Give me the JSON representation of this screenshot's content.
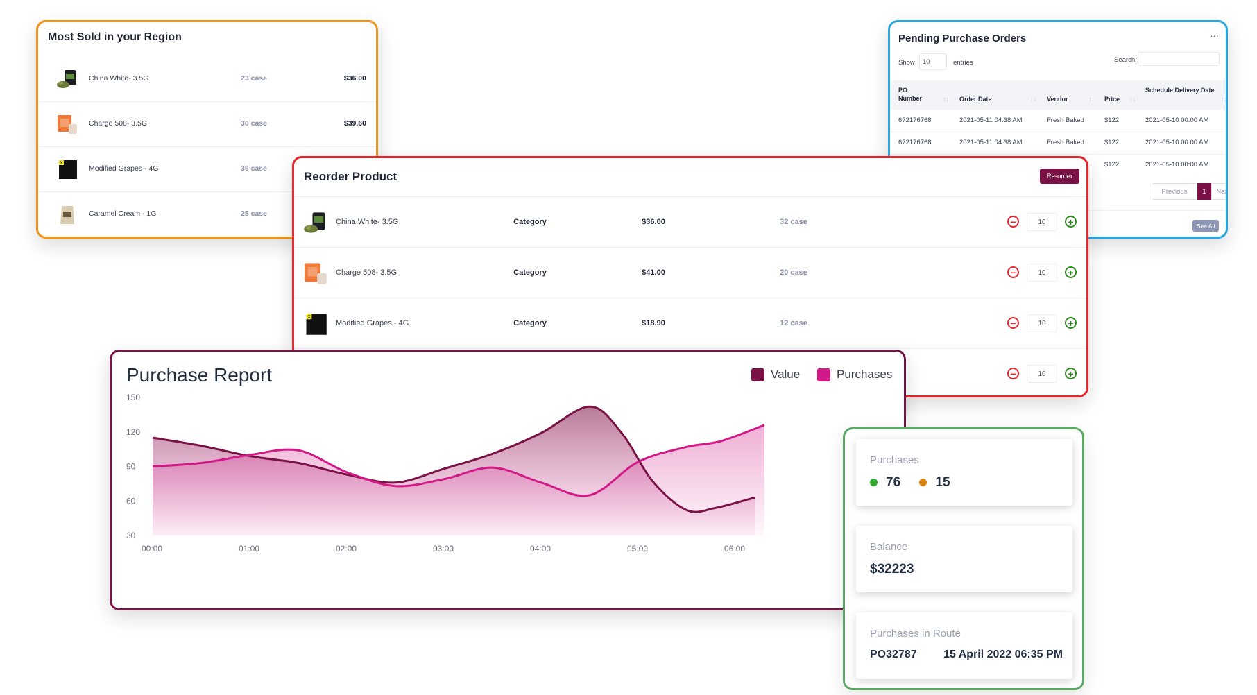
{
  "most_sold": {
    "title": "Most Sold in your Region",
    "items": [
      {
        "name": "China White- 3.5G",
        "cases": "23 case",
        "price": "$36.00",
        "thumb": "flower-jar-icon"
      },
      {
        "name": "Charge 508- 3.5G",
        "cases": "30 case",
        "price": "$39.60",
        "thumb": "orange-box-icon"
      },
      {
        "name": "Modified Grapes - 4G",
        "cases": "36 case",
        "price": "",
        "thumb": "black-box-icon"
      },
      {
        "name": "Caramel Cream - 1G",
        "cases": "25 case",
        "price": "",
        "thumb": "pouch-icon"
      }
    ]
  },
  "pending": {
    "title": "Pending Purchase Orders",
    "menu_icon": "ellipsis-icon",
    "show_label": "Show",
    "show_value": "10",
    "entries_label": "entries",
    "search_label": "Search:",
    "search_value": "",
    "columns": [
      "PO Number",
      "Order Date",
      "Vendor",
      "Price",
      "Schedule Delivery Date"
    ],
    "rows": [
      {
        "po": "672176768",
        "date": "2021-05-11 04:38 AM",
        "vendor": "Fresh Baked",
        "price": "$122",
        "delivery": "2021-05-10 00:00 AM"
      },
      {
        "po": "672176768",
        "date": "2021-05-11 04:38 AM",
        "vendor": "Fresh Baked",
        "price": "$122",
        "delivery": "2021-05-10 00:00 AM"
      },
      {
        "po": "",
        "date": "",
        "vendor": "",
        "price": "$122",
        "delivery": "2021-05-10 00:00 AM"
      }
    ],
    "pagination": {
      "previous": "Previous",
      "current": "1",
      "next": "Next"
    },
    "see_all": "See All"
  },
  "reorder": {
    "title": "Reorder Product",
    "button": "Re-order",
    "items": [
      {
        "name": "China White- 3.5G",
        "category": "Category",
        "price": "$36.00",
        "cases": "32 case",
        "qty": "10"
      },
      {
        "name": "Charge 508- 3.5G",
        "category": "Category",
        "price": "$41.00",
        "cases": "20 case",
        "qty": "10"
      },
      {
        "name": "Modified Grapes - 4G",
        "category": "Category",
        "price": "$18.90",
        "cases": "12 case",
        "qty": "10"
      },
      {
        "name": "",
        "category": "",
        "price": "",
        "cases": "",
        "qty": "10"
      }
    ]
  },
  "report": {
    "title": "Purchase Report",
    "legend": [
      {
        "name": "Value",
        "color": "#7a1245"
      },
      {
        "name": "Purchases",
        "color": "#d11a87"
      }
    ]
  },
  "chart_data": {
    "type": "area",
    "x": [
      "00:00",
      "01:00",
      "02:00",
      "03:00",
      "04:00",
      "05:00",
      "06:00"
    ],
    "y_ticks": [
      150,
      120,
      90,
      60,
      30
    ],
    "ylim": [
      30,
      150
    ],
    "grid": false,
    "legend_position": "top-right",
    "series": [
      {
        "name": "Value",
        "color": "#7a1245",
        "points": [
          [
            0,
            115
          ],
          [
            0.5,
            108
          ],
          [
            1,
            99
          ],
          [
            1.5,
            93
          ],
          [
            2,
            83
          ],
          [
            2.5,
            76
          ],
          [
            3,
            88
          ],
          [
            3.5,
            101
          ],
          [
            4,
            119
          ],
          [
            4.5,
            142
          ],
          [
            4.83,
            119
          ],
          [
            5.15,
            77
          ],
          [
            5.5,
            52
          ],
          [
            5.8,
            54
          ],
          [
            6.2,
            63
          ]
        ]
      },
      {
        "name": "Purchases",
        "color": "#d11a87",
        "points": [
          [
            0,
            90
          ],
          [
            0.5,
            93
          ],
          [
            1,
            100
          ],
          [
            1.5,
            104
          ],
          [
            2,
            85
          ],
          [
            2.5,
            73
          ],
          [
            3,
            79
          ],
          [
            3.5,
            89
          ],
          [
            4,
            76
          ],
          [
            4.5,
            65
          ],
          [
            5,
            94
          ],
          [
            5.5,
            107
          ],
          [
            5.85,
            112
          ],
          [
            6.3,
            126
          ]
        ]
      }
    ]
  },
  "stats": {
    "purchases": {
      "label": "Purchases",
      "green_value": "76",
      "orange_value": "15",
      "green_color": "#2da82d",
      "orange_color": "#d9820b"
    },
    "balance": {
      "label": "Balance",
      "value": "$32223"
    },
    "route": {
      "label": "Purchases in Route",
      "po": "PO32787",
      "date": "15 April 2022 06:35 PM"
    }
  }
}
